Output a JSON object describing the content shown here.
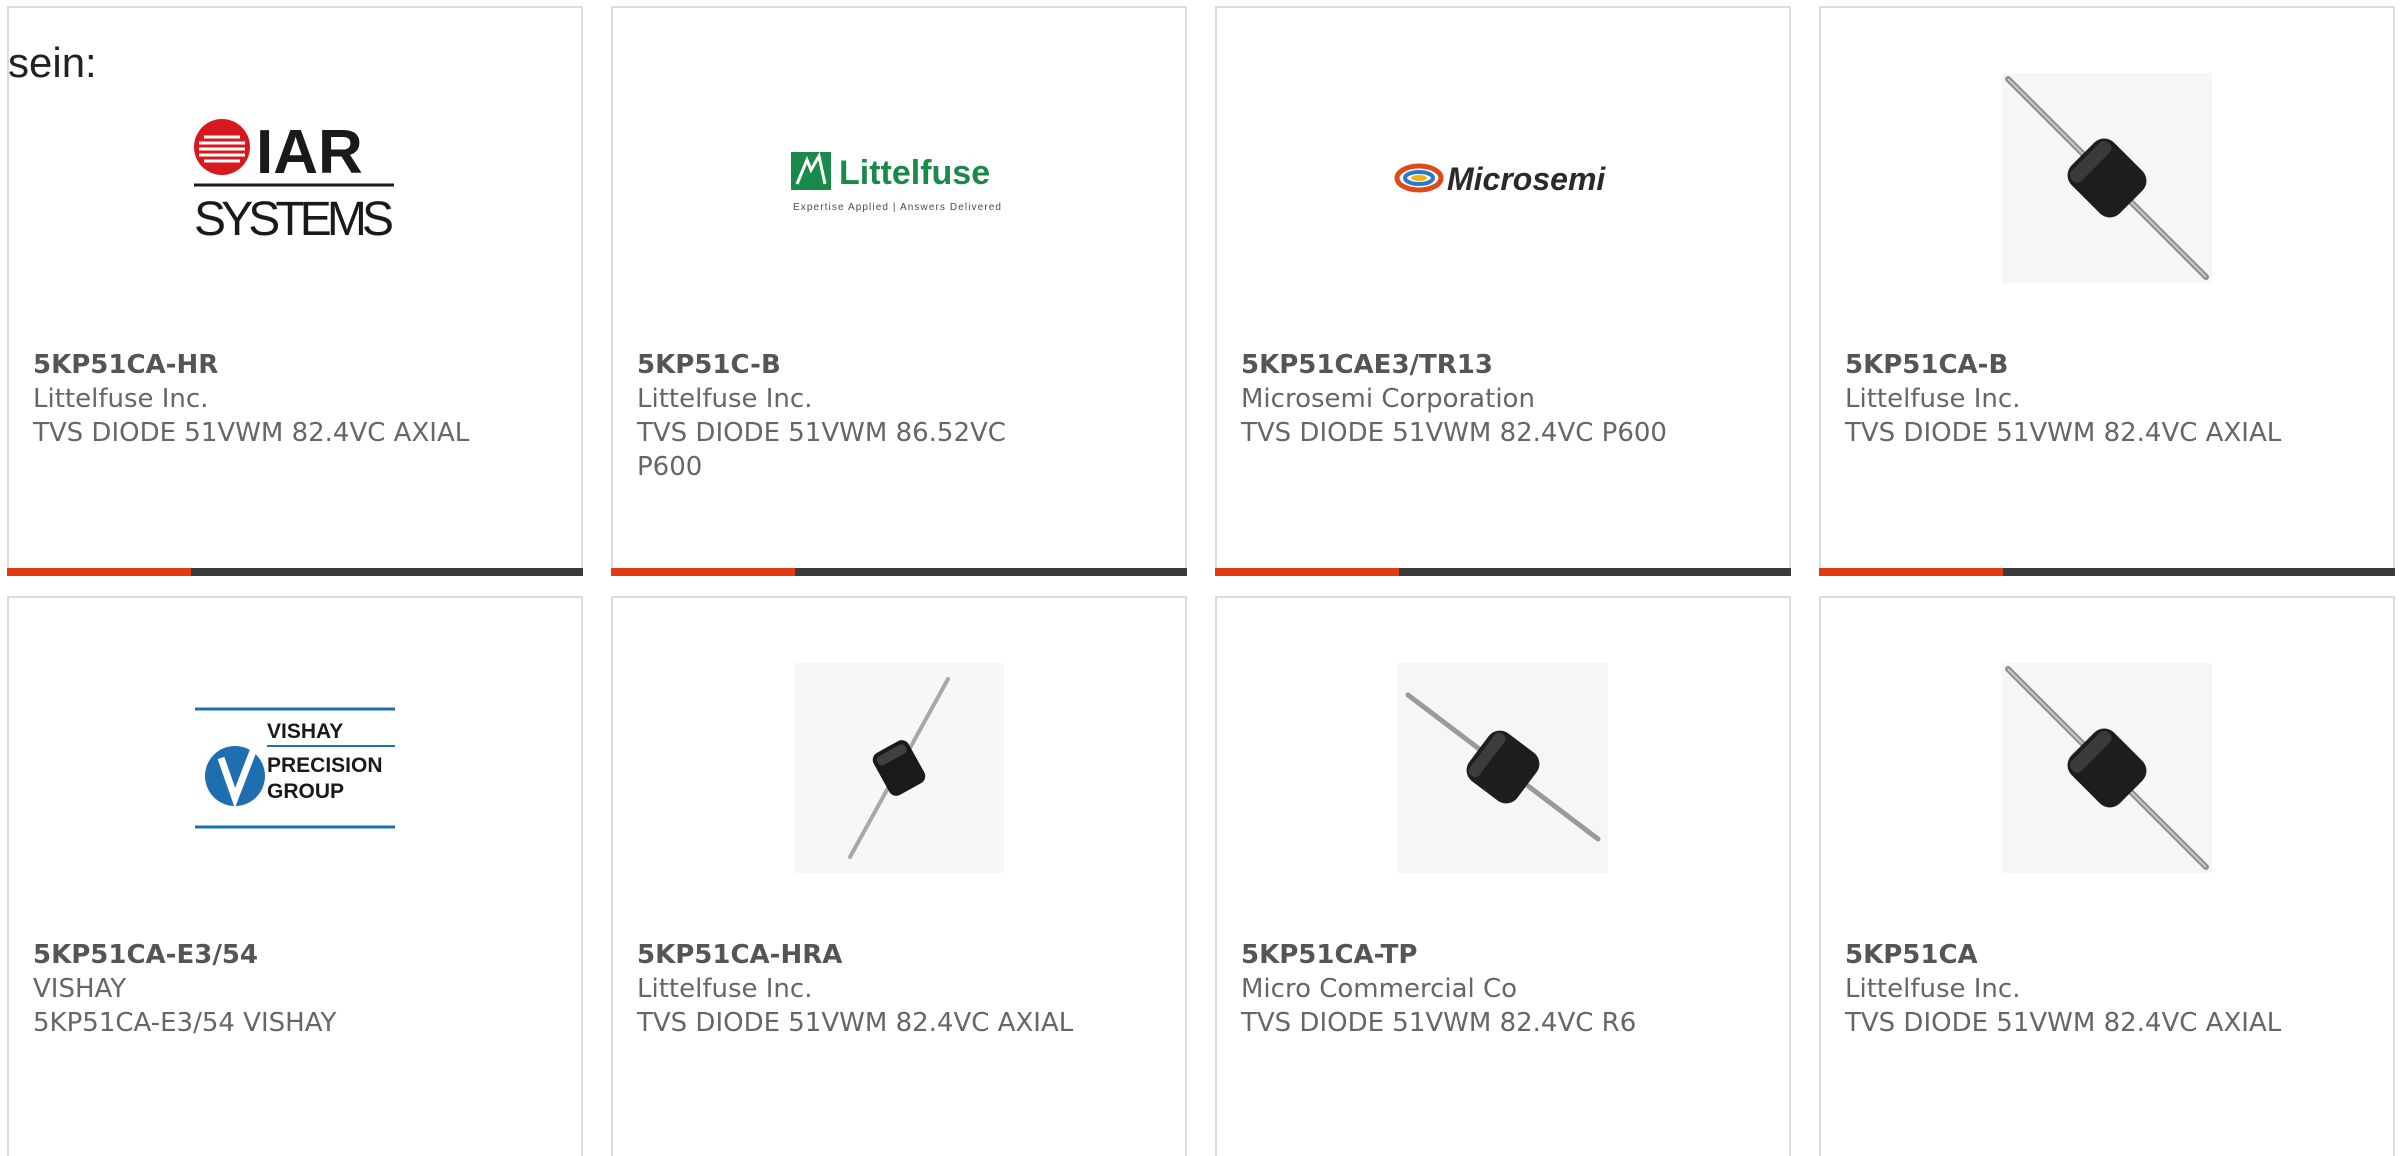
{
  "lead_text": "sein:",
  "colors": {
    "accent": "#e03c10",
    "bar_dark": "#3b3b3b"
  },
  "cards": [
    {
      "part_number": "5KP51CA-HR",
      "manufacturer": "Littelfuse Inc.",
      "description": "TVS DIODE 51VWM 82.4VC AXIAL",
      "image": "iar-systems-logo",
      "logo_text": [
        "IAR",
        "SYSTEMS"
      ]
    },
    {
      "part_number": "5KP51C-B",
      "manufacturer": "Littelfuse Inc.",
      "description": "TVS DIODE 51VWM 86.52VC P600",
      "image": "littelfuse-logo",
      "logo_text": [
        "Littelfuse",
        "Expertise Applied | Answers Delivered"
      ]
    },
    {
      "part_number": "5KP51CAE3/TR13",
      "manufacturer": "Microsemi Corporation",
      "description": "TVS DIODE 51VWM 82.4VC P600",
      "image": "microsemi-logo",
      "logo_text": [
        "Microsemi"
      ]
    },
    {
      "part_number": "5KP51CA-B",
      "manufacturer": "Littelfuse Inc.",
      "description": "TVS DIODE 51VWM 82.4VC AXIAL",
      "image": "axial-diode-photo"
    },
    {
      "part_number": "5KP51CA-E3/54",
      "manufacturer": "VISHAY",
      "description": "5KP51CA-E3/54 VISHAY",
      "image": "vishay-precision-group-logo",
      "logo_text": [
        "VISHAY",
        "PRECISION",
        "GROUP"
      ]
    },
    {
      "part_number": "5KP51CA-HRA",
      "manufacturer": "Littelfuse Inc.",
      "description": "TVS DIODE 51VWM 82.4VC AXIAL",
      "image": "axial-diode-photo"
    },
    {
      "part_number": "5KP51CA-TP",
      "manufacturer": "Micro Commercial Co",
      "description": "TVS DIODE 51VWM 82.4VC R6",
      "image": "axial-diode-photo"
    },
    {
      "part_number": "5KP51CA",
      "manufacturer": "Littelfuse Inc.",
      "description": "TVS DIODE 51VWM 82.4VC AXIAL",
      "image": "axial-diode-photo"
    }
  ]
}
